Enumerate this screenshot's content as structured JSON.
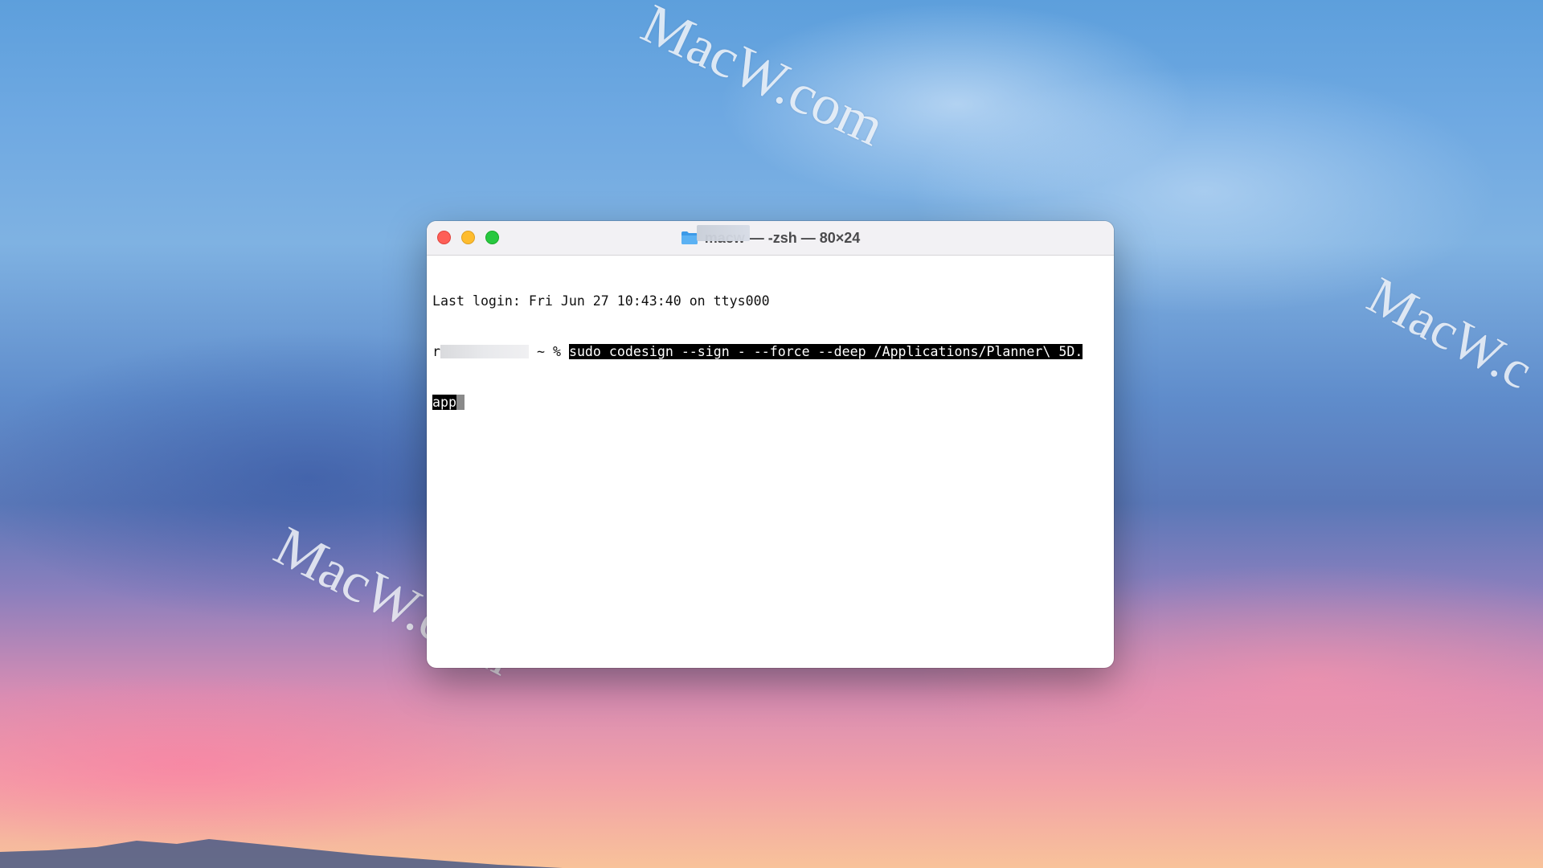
{
  "wallpaper": {
    "watermarks": [
      "MacW.com",
      "MacW.c",
      "MacW.com"
    ]
  },
  "window": {
    "title_user": "macw",
    "title_rest": "— -zsh — 80×24",
    "controls": [
      "close",
      "minimize",
      "zoom"
    ]
  },
  "terminal": {
    "last_login": "Last login: Fri Jun 27 10:43:40 on ttys000",
    "prompt_initial": "r",
    "prompt_suffix": " ~ % ",
    "command_line1": "sudo codesign --sign - --force --deep /Applications/Planner\\ 5D.",
    "command_line2": "app"
  },
  "colors": {
    "close": "#fe5f57",
    "minimize": "#febc2e",
    "zoom": "#28c840",
    "selection_bg": "#000000",
    "selection_fg": "#ffffff"
  },
  "icons": {
    "title_icon": "folder-icon"
  }
}
